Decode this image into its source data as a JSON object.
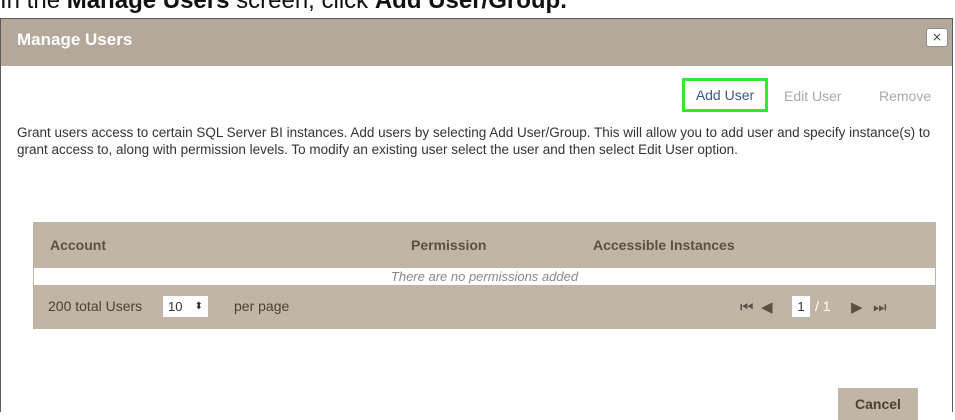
{
  "caption": {
    "prefix": "In the ",
    "screen_name": "Manage Users",
    "middle": " screen, click ",
    "action": "Add User/Group."
  },
  "dialog": {
    "title": "Manage Users",
    "close_label": "×"
  },
  "toolbar": {
    "add_user": "Add User",
    "edit_user": "Edit User",
    "remove": "Remove"
  },
  "description": "Grant users access to certain SQL Server BI instances. Add users by selecting Add User/Group. This will allow you to add user and specify instance(s) to grant access to, along with permission levels. To modify an existing user select the user and then select Edit User option.",
  "grid": {
    "columns": [
      "Account",
      "Permission",
      "Accessible Instances"
    ],
    "empty_message": "There are no permissions added",
    "footer": {
      "total_users": "200 total Users",
      "page_size": "10",
      "per_page_label": "per page",
      "current_page": "1",
      "page_total": "/ 1"
    }
  },
  "buttons": {
    "cancel": "Cancel"
  },
  "icons": {
    "close": "close-icon",
    "first": "first-page-icon",
    "prev": "prev-page-icon",
    "next": "next-page-icon",
    "last": "last-page-icon",
    "spinner": "spinner-icon"
  },
  "colors": {
    "titlebar": "#b3a899",
    "grid": "#c1b6a5",
    "highlight": "#39e339",
    "link": "#3a5a8a"
  }
}
